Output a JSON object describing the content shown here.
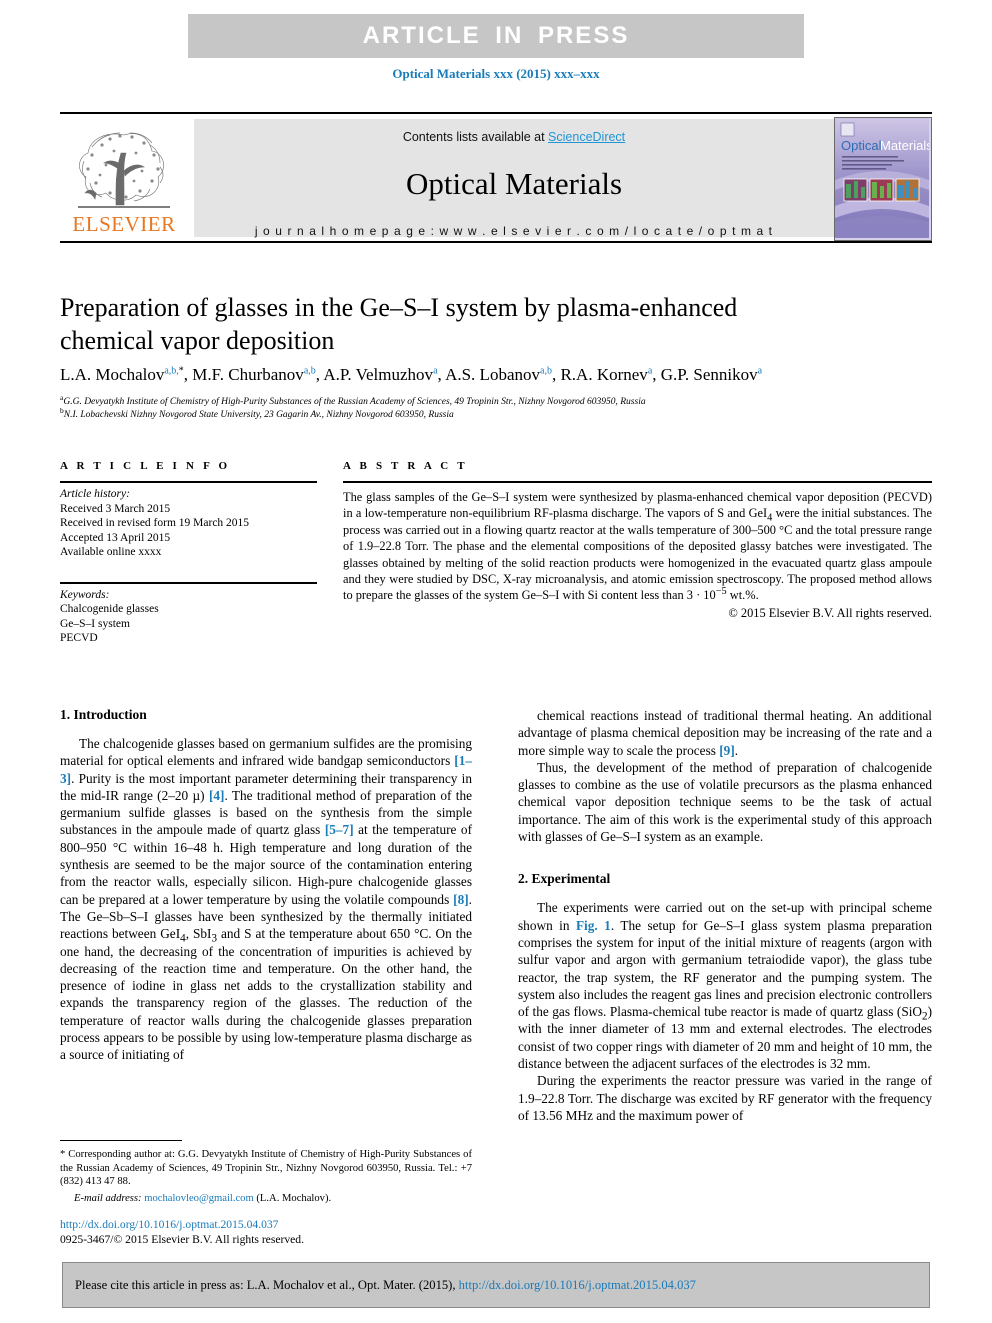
{
  "banner": {
    "article_in_press": "ARTICLE IN PRESS"
  },
  "running_head": "Optical Materials xxx (2015) xxx–xxx",
  "masthead": {
    "contents_prefix": "Contents lists available at ",
    "sciencedirect": "ScienceDirect",
    "journal_name": "Optical Materials",
    "homepage": "j o u r n a l   h o m e p a g e :   w w w . e l s e v i e r . c o m / l o c a t e / o p t m a t",
    "publisher": "ELSEVIER",
    "cover_title_a": "Optical",
    "cover_title_b": "Materials",
    "accent_blue": "#1a7bb9",
    "elsevier_orange": "#e87722",
    "band_gray": "#e4e4e4"
  },
  "article": {
    "title_line1": "Preparation of glasses in the Ge–S–I system by plasma-enhanced",
    "title_line2": "chemical vapor deposition",
    "authors": [
      {
        "name": "L.A. Mochalov",
        "marks": "a,b,",
        "star": "*"
      },
      {
        "name": "M.F. Churbanov",
        "marks": "a,b",
        "star": ""
      },
      {
        "name": "A.P. Velmuzhov",
        "marks": "a",
        "star": ""
      },
      {
        "name": "A.S. Lobanov",
        "marks": "a,b",
        "star": ""
      },
      {
        "name": "R.A. Kornev",
        "marks": "a",
        "star": ""
      },
      {
        "name": "G.P. Sennikov",
        "marks": "a",
        "star": ""
      }
    ],
    "affiliations": [
      {
        "mark": "a",
        "text": "G.G. Devyatykh Institute of Chemistry of High-Purity Substances of the Russian Academy of Sciences, 49 Tropinin Str., Nizhny Novgorod 603950, Russia"
      },
      {
        "mark": "b",
        "text": "N.I. Lobachevski Nizhny Novgorod State University, 23 Gagarin Av., Nizhny Novgorod 603950, Russia"
      }
    ]
  },
  "article_info": {
    "heading": "A R T I C L E   I N F O",
    "history_label": "Article history:",
    "history": [
      "Received 3 March 2015",
      "Received in revised form 19 March 2015",
      "Accepted 13 April 2015",
      "Available online xxxx"
    ],
    "keywords_label": "Keywords:",
    "keywords": [
      "Chalcogenide glasses",
      "Ge–S–I system",
      "PECVD"
    ]
  },
  "abstract": {
    "heading": "A B S T R A C T",
    "text": "The glass samples of the Ge–S–I system were synthesized by plasma-enhanced chemical vapor deposition (PECVD) in a low-temperature non-equilibrium RF-plasma discharge. The vapors of S and GeI4 were the initial substances. The process was carried out in a flowing quartz reactor at the walls temperature of 300–500 °C and the total pressure range of 1.9–22.8 Torr. The phase and the elemental compositions of the deposited glassy batches were investigated. The glasses obtained by melting of the solid reaction products were homogenized in the evacuated quartz glass ampoule and they were studied by DSC, X-ray microanalysis, and atomic emission spectroscopy. The proposed method allows to prepare the glasses of the system Ge–S–I with Si content less than 3 · 10−5 wt.%.",
    "copyright": "© 2015 Elsevier B.V. All rights reserved."
  },
  "sections": {
    "intro_heading": "1. Introduction",
    "intro_p1_a": "The chalcogenide glasses based on germanium sulfides are the promising material for optical elements and infrared wide bandgap semiconductors ",
    "intro_ref1": "[1–3]",
    "intro_p1_b": ". Purity is the most important parameter determining their transparency in the mid-IR range (2–20 µ) ",
    "intro_ref2": "[4]",
    "intro_p1_c": ". The traditional method of preparation of the germanium sulfide glasses is based on the synthesis from the simple substances in the ampoule made of quartz glass ",
    "intro_ref3": "[5–7]",
    "intro_p1_d": " at the temperature of 800–950 °C within 16–48 h. High temperature and long duration of the synthesis are seemed to be the major source of the contamination entering from the reactor walls, especially silicon. High-pure chalcogenide glasses can be prepared at a lower temperature by using the volatile compounds ",
    "intro_ref4": "[8]",
    "intro_p1_e": ". The Ge–Sb–S–I glasses have been synthesized by the thermally initiated reactions between GeI4, SbI3 and S at the temperature about 650 °C. On the one hand, the decreasing of the concentration of impurities is achieved by decreasing of the reaction time and temperature. On the other hand, the presence of iodine in glass net adds to the crystallization stability and expands the transparency region of the glasses. The reduction of the temperature of reactor walls during the chalcogenide glasses preparation process appears to be possible by using low-temperature plasma discharge as a source of initiating of",
    "right_p1_a": "chemical reactions instead of traditional thermal heating. An additional advantage of plasma chemical deposition may be increasing of the rate and a more simple way to scale the process ",
    "right_ref9": "[9]",
    "right_p1_b": ".",
    "right_p2": "Thus, the development of the method of preparation of chalcogenide glasses to combine as the use of volatile precursors as the plasma enhanced chemical vapor deposition technique seems to be the task of actual importance. The aim of this work is the experimental study of this approach with glasses of Ge–S–I system as an example.",
    "exp_heading": "2. Experimental",
    "exp_p1_a": "The experiments were carried out on the set-up with principal scheme shown in ",
    "exp_figref": "Fig. 1",
    "exp_p1_b": ". The setup for Ge–S–I glass system plasma preparation comprises the system for input of the initial mixture of reagents (argon with sulfur vapor and argon with germanium tetraiodide vapor), the glass tube reactor, the trap system, the RF generator and the pumping system. The system also includes the reagent gas lines and precision electronic controllers of the gas flows. Plasma-chemical tube reactor is made of quartz glass (SiO2) with the inner diameter of 13 mm and external electrodes. The electrodes consist of two copper rings with diameter of 20 mm and height of 10 mm, the distance between the adjacent surfaces of the electrodes is 32 mm.",
    "exp_p2": "During the experiments the reactor pressure was varied in the range of 1.9–22.8 Torr. The discharge was excited by RF generator with the frequency of 13.56 MHz and the maximum power of"
  },
  "footnote": {
    "star": "*",
    "corresp": "Corresponding author at: G.G. Devyatykh Institute of Chemistry of High-Purity Substances of the Russian Academy of Sciences, 49 Tropinin Str., Nizhny Novgorod 603950, Russia. Tel.: +7 (832) 413 47 88.",
    "email_label": "E-mail address:",
    "email": "mochalovleo@gmail.com",
    "email_owner": "(L.A. Mochalov).",
    "doi": "http://dx.doi.org/10.1016/j.optmat.2015.04.037",
    "issn_line": "0925-3467/© 2015 Elsevier B.V. All rights reserved."
  },
  "cite_bar": {
    "prefix": "Please cite this article in press as: L.A. Mochalov et al., Opt. Mater. (2015), ",
    "url": "http://dx.doi.org/10.1016/j.optmat.2015.04.037"
  }
}
